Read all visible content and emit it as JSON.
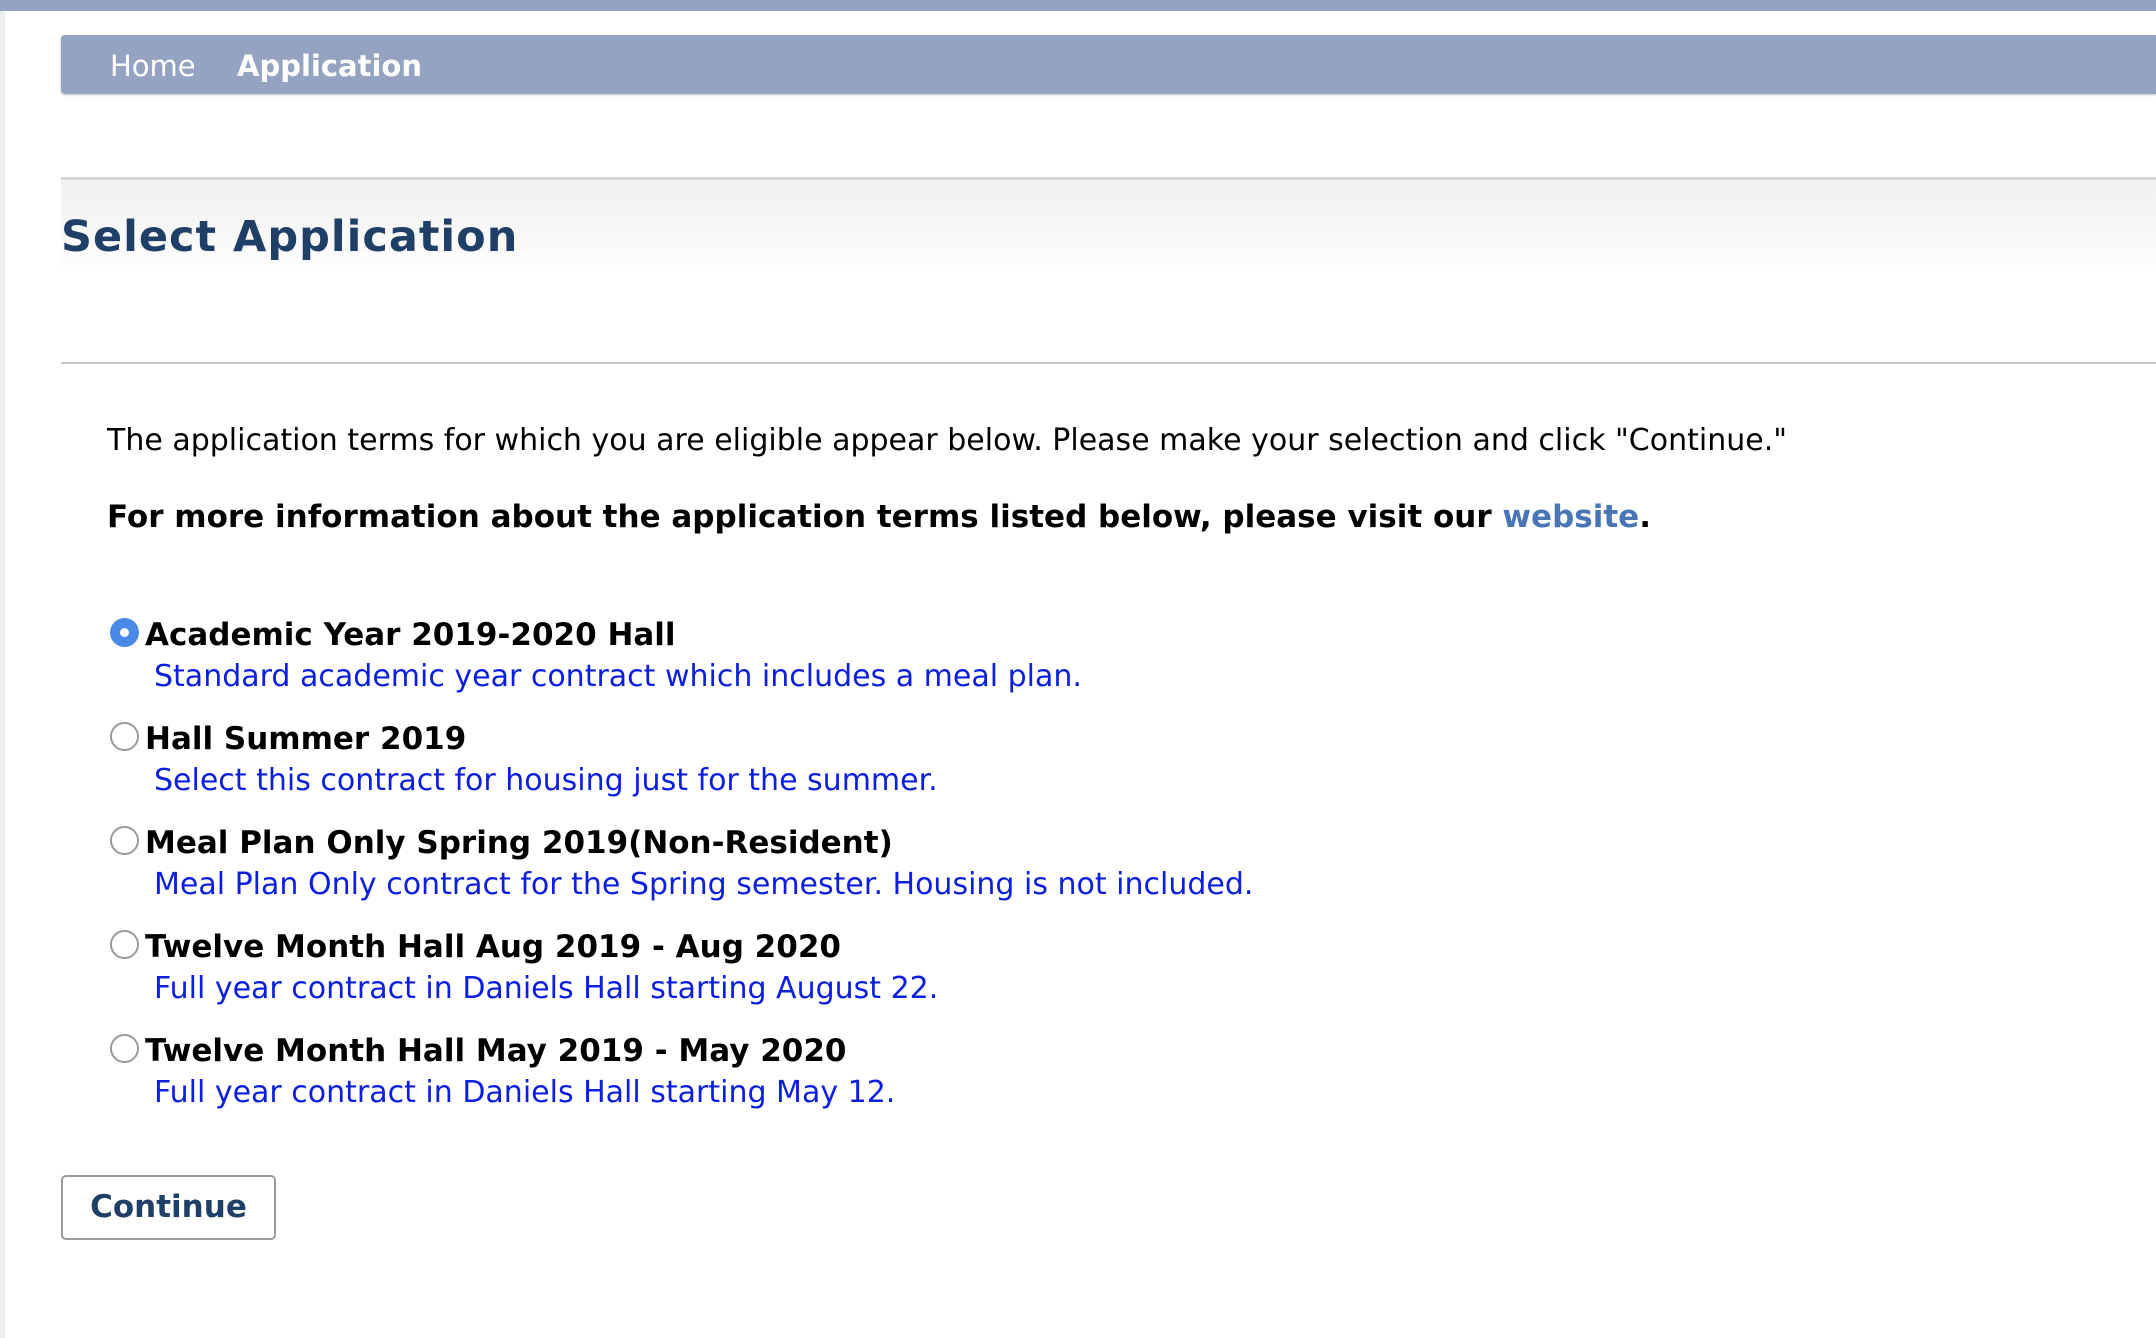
{
  "nav": {
    "items": [
      {
        "label": "Home",
        "active": false
      },
      {
        "label": "Application",
        "active": true
      }
    ]
  },
  "page": {
    "title": "Select Application",
    "intro": "The application terms for which you are eligible appear below. Please make your selection and click \"Continue.\"",
    "more_info_prefix": "For more information about the application terms listed below, please visit our ",
    "more_info_link": "website",
    "more_info_suffix": "."
  },
  "options": [
    {
      "title": "Academic Year 2019-2020 Hall",
      "description": "Standard academic year contract which includes a meal plan.",
      "selected": true
    },
    {
      "title": "Hall Summer 2019",
      "description": "Select this contract for housing just for the summer.",
      "selected": false
    },
    {
      "title": "Meal Plan Only Spring 2019(Non-Resident)",
      "description": "Meal Plan Only contract for the Spring semester. Housing is not included.",
      "selected": false
    },
    {
      "title": "Twelve Month Hall Aug 2019 - Aug 2020",
      "description": "Full year contract in Daniels Hall starting August 22.",
      "selected": false
    },
    {
      "title": "Twelve Month Hall May 2019 - May 2020",
      "description": "Full year contract in Daniels Hall starting May 12.",
      "selected": false
    }
  ],
  "actions": {
    "continue_label": "Continue"
  },
  "colors": {
    "nav_bg": "#95a3c2",
    "title": "#1f3f66",
    "link": "#4a76b5",
    "description": "#0c1fe0",
    "radio_selected": "#4a8ae6"
  }
}
